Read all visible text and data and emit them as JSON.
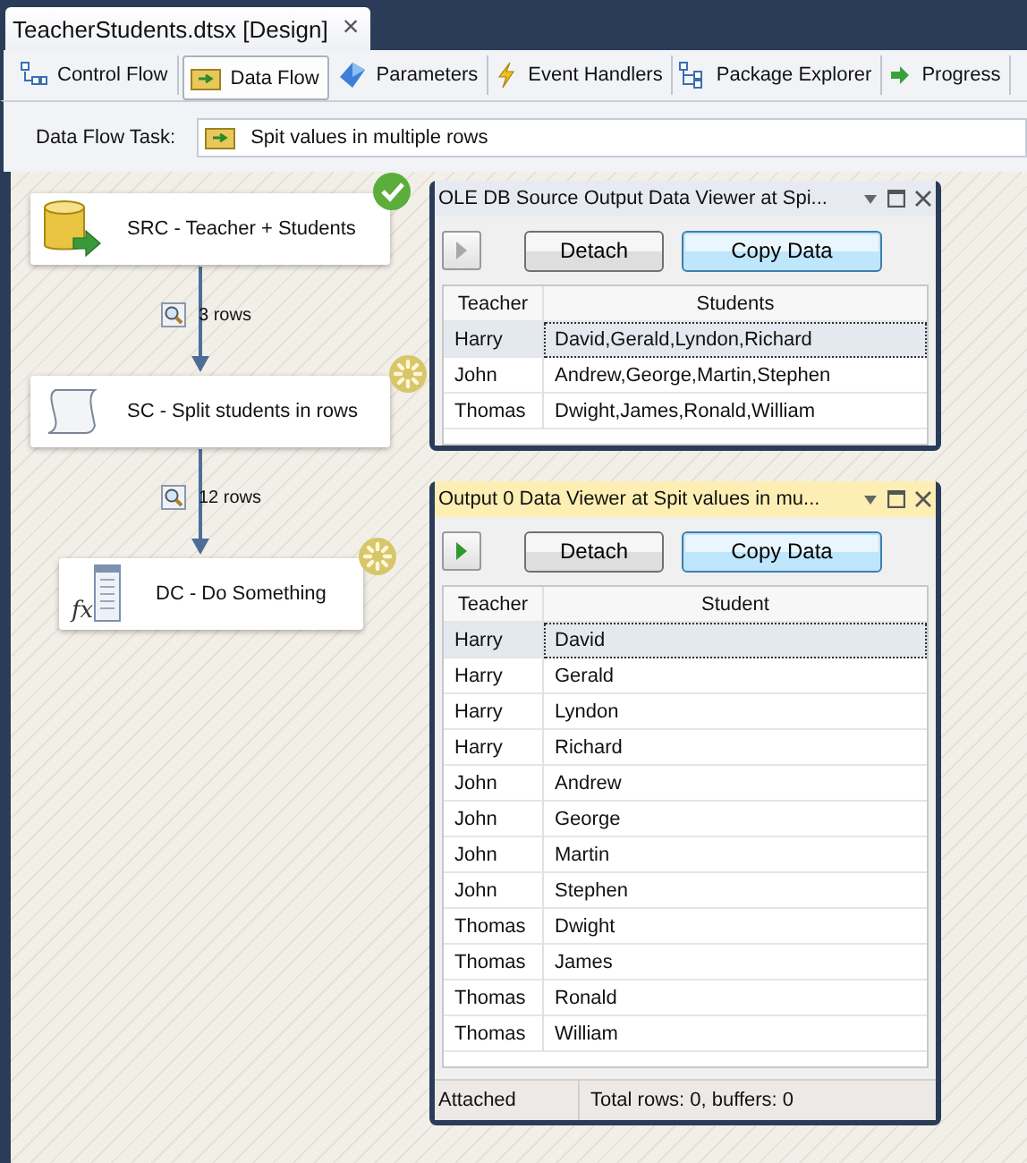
{
  "document_tab": {
    "title": "TeacherStudents.dtsx [Design]",
    "close": "×"
  },
  "tabs": [
    {
      "label": "Control Flow",
      "selected": false
    },
    {
      "label": "Data Flow",
      "selected": true
    },
    {
      "label": "Parameters",
      "selected": false
    },
    {
      "label": "Event Handlers",
      "selected": false
    },
    {
      "label": "Package Explorer",
      "selected": false
    },
    {
      "label": "Progress",
      "selected": false
    }
  ],
  "task_bar": {
    "label": "Data Flow Task:",
    "value": "Spit values in multiple rows"
  },
  "nodes": [
    {
      "label": "SRC - Teacher + Students",
      "kind": "source",
      "succeeded": true
    },
    {
      "label": "SC - Split students in rows",
      "kind": "script",
      "succeeded": false
    },
    {
      "label": "DC - Do Something",
      "kind": "derived",
      "icon_text": "fx",
      "succeeded": false
    }
  ],
  "paths": [
    {
      "label": "3 rows"
    },
    {
      "label": "12 rows"
    }
  ],
  "viewers": [
    {
      "title": "OLE DB Source Output Data Viewer at Spi...",
      "active": false,
      "play_enabled": false,
      "buttons": [
        "Detach",
        "Copy Data"
      ],
      "columns": [
        "Teacher",
        "Students"
      ],
      "rows": [
        {
          "cells": [
            "Harry",
            "David,Gerald,Lyndon,Richard"
          ],
          "selected": true
        },
        {
          "cells": [
            "John",
            "Andrew,George,Martin,Stephen"
          ],
          "selected": false
        },
        {
          "cells": [
            "Thomas",
            "Dwight,James,Ronald,William"
          ],
          "selected": false
        }
      ]
    },
    {
      "title": "Output 0 Data Viewer at Spit values in mu...",
      "active": true,
      "play_enabled": true,
      "buttons": [
        "Detach",
        "Copy Data"
      ],
      "columns": [
        "Teacher",
        "Student"
      ],
      "rows": [
        {
          "cells": [
            "Harry",
            "David"
          ],
          "selected": true
        },
        {
          "cells": [
            "Harry",
            "Gerald"
          ],
          "selected": false
        },
        {
          "cells": [
            "Harry",
            "Lyndon"
          ],
          "selected": false
        },
        {
          "cells": [
            "Harry",
            "Richard"
          ],
          "selected": false
        },
        {
          "cells": [
            "John",
            "Andrew"
          ],
          "selected": false
        },
        {
          "cells": [
            "John",
            "George"
          ],
          "selected": false
        },
        {
          "cells": [
            "John",
            "Martin"
          ],
          "selected": false
        },
        {
          "cells": [
            "John",
            "Stephen"
          ],
          "selected": false
        },
        {
          "cells": [
            "Thomas",
            "Dwight"
          ],
          "selected": false
        },
        {
          "cells": [
            "Thomas",
            "James"
          ],
          "selected": false
        },
        {
          "cells": [
            "Thomas",
            "Ronald"
          ],
          "selected": false
        },
        {
          "cells": [
            "Thomas",
            "William"
          ],
          "selected": false
        }
      ],
      "status": [
        "Attached",
        "Total rows: 0, buffers: 0"
      ]
    }
  ]
}
